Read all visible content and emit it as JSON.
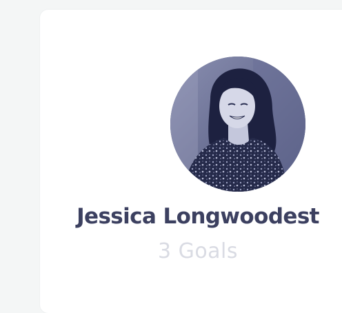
{
  "profile": {
    "name": "Jessica Longwoodest",
    "goals_label": "3 Goals",
    "avatar_icon": "profile-photo",
    "colors": {
      "name": "#3c4060",
      "goals": "#d9dbe3",
      "avatar_tint": "#3b4166"
    }
  }
}
